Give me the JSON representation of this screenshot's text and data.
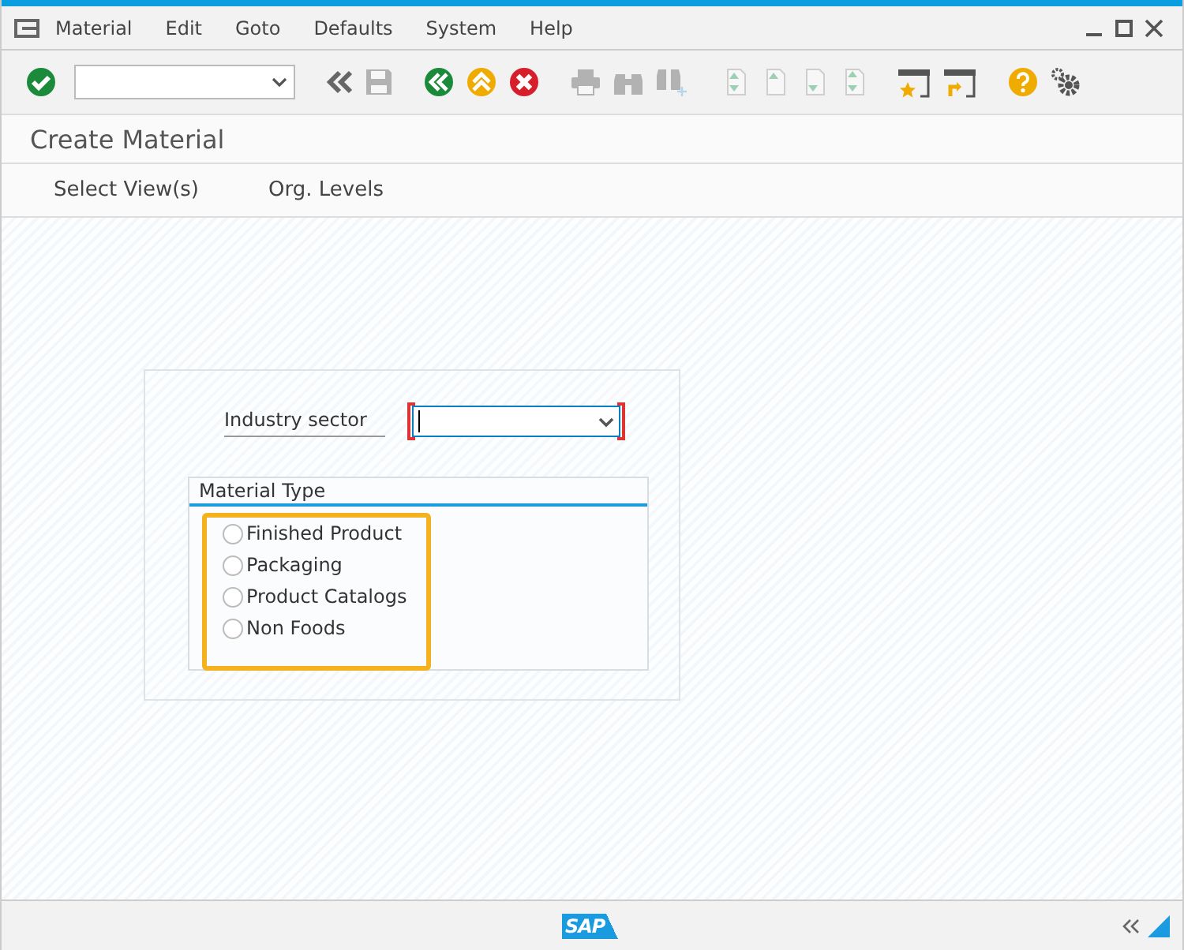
{
  "window": {
    "title": "Create Material"
  },
  "menu": [
    "Material",
    "Edit",
    "Goto",
    "Defaults",
    "System",
    "Help"
  ],
  "toolbar": [
    {
      "kind": "enter",
      "disabled": false
    },
    {
      "kind": "command-field"
    },
    {
      "kind": "back-arrows",
      "disabled": false
    },
    {
      "kind": "save",
      "disabled": true
    },
    {
      "kind": "back",
      "disabled": false
    },
    {
      "kind": "exit",
      "disabled": false
    },
    {
      "kind": "cancel",
      "disabled": false
    },
    {
      "kind": "print",
      "disabled": true
    },
    {
      "kind": "find",
      "disabled": true
    },
    {
      "kind": "find-next",
      "disabled": true
    },
    {
      "kind": "first-page",
      "disabled": true
    },
    {
      "kind": "previous-page",
      "disabled": true
    },
    {
      "kind": "next-page",
      "disabled": true
    },
    {
      "kind": "last-page",
      "disabled": true
    },
    {
      "kind": "new-session",
      "disabled": false
    },
    {
      "kind": "shortcut",
      "disabled": false
    },
    {
      "kind": "help",
      "disabled": false
    },
    {
      "kind": "settings",
      "disabled": false
    }
  ],
  "app_toolbar": [
    "Select View(s)",
    "Org. Levels"
  ],
  "form": {
    "industry_sector": {
      "label": "Industry sector",
      "required": true
    },
    "material_type": {
      "title": "Material Type",
      "highlighted": true,
      "options": [
        {
          "label": "Finished Product",
          "selected": false
        },
        {
          "label": "Packaging",
          "selected": false
        },
        {
          "label": "Product Catalogs",
          "selected": false
        },
        {
          "label": "Non Foods",
          "selected": false
        }
      ]
    }
  },
  "status_bar": {
    "logo": "SAP"
  }
}
